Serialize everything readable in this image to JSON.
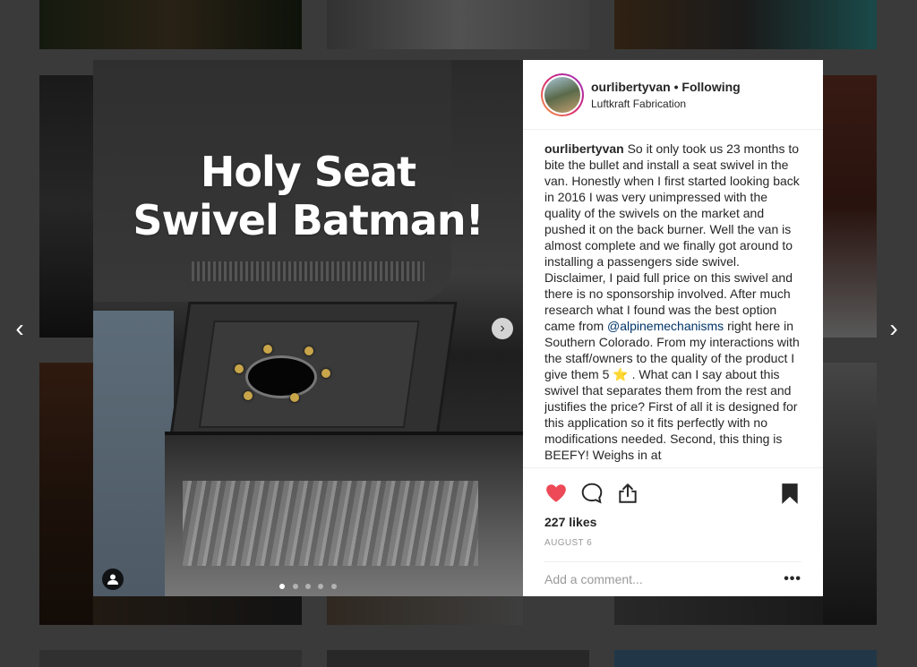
{
  "post": {
    "overlay_title_line1": "Holy Seat",
    "overlay_title_line2": "Swivel Batman!",
    "carousel": {
      "count": 5,
      "active_index": 0
    }
  },
  "header": {
    "username": "ourlibertyvan",
    "separator": "•",
    "follow_label": "Following",
    "location": "Luftkraft Fabrication"
  },
  "caption": {
    "username": "ourlibertyvan",
    "text_part1": "So it only took us 23 months to bite the bullet and install a seat swivel in the van. Honestly when I first started looking back in 2016 I was very unimpressed with the quality of the swivels on the market and pushed it on the back burner. Well the van is almost complete and we finally got around to installing a passengers side swivel. Disclaimer, I paid full price on this swivel and there is no sponsorship involved. After much research what I found was the best option came from",
    "mention": "@alpinemechanisms",
    "text_part2": "right here in Southern Colorado. From my interactions with the staff/owners to the quality of the product I give them 5 ⭐️ . What can I say about this swivel that separates them from the rest and justifies the price? First of all it is designed for this application so it fits perfectly with no modifications needed. Second, this thing is BEEFY! Weighs in at"
  },
  "engagement": {
    "likes": "227 likes",
    "date": "AUGUST 6"
  },
  "comment": {
    "placeholder": "Add a comment...",
    "more": "•••"
  },
  "nav": {
    "prev": "‹",
    "next": "›",
    "media_next": "›"
  },
  "colors": {
    "like_red": "#ed4956",
    "mention_blue": "#003569",
    "avatar_ring_start": "#f9a03f",
    "avatar_ring_end": "#962fbf"
  },
  "icons": {
    "like": "heart-icon",
    "comment": "comment-icon",
    "share": "share-icon",
    "save": "bookmark-icon",
    "user_tag": "user-tag-icon"
  }
}
